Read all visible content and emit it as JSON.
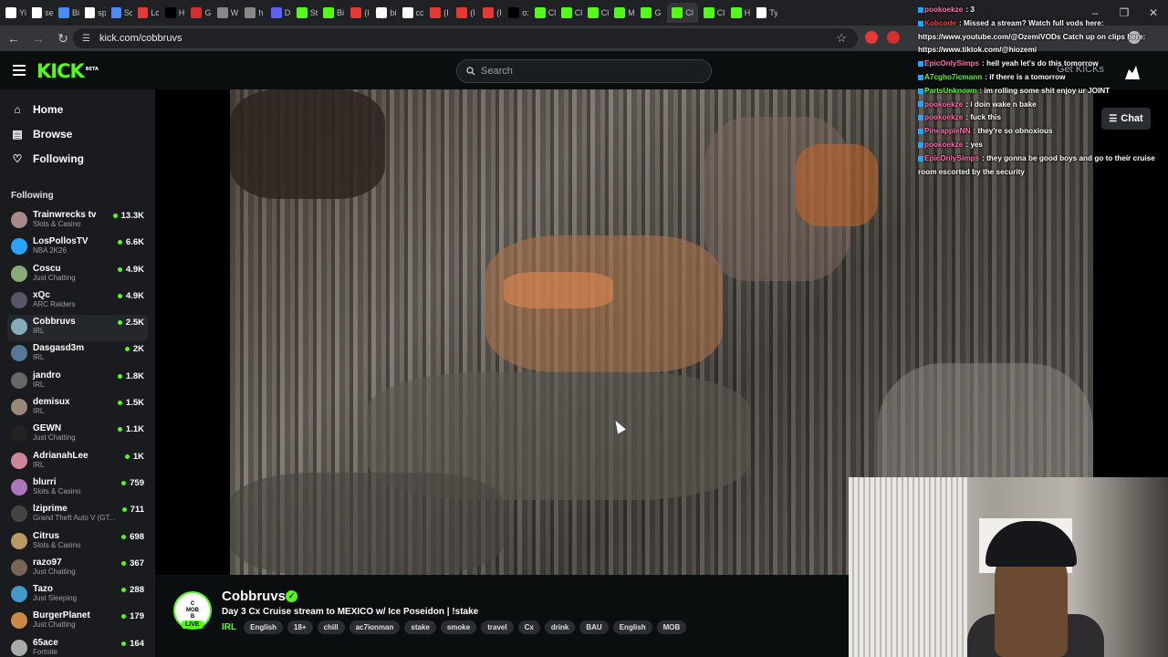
{
  "browser": {
    "url": "kick.com/cobbruvs",
    "tabs": [
      "Yi",
      "se",
      "Bi",
      "sp",
      "Sc",
      "Lc",
      "H",
      "G",
      "W",
      "h",
      "D",
      "St",
      "Bi",
      "(I",
      "bi",
      "cc",
      "(I",
      "(I",
      "(I",
      "o:",
      "Cl",
      "Cl",
      "Cl",
      "M",
      "G",
      "Cl",
      "Cl",
      "H",
      "Ty"
    ]
  },
  "header": {
    "logo": "KICK",
    "logo_badge": "BETA",
    "search_placeholder": "Search",
    "get_kicks": "Get KICKs"
  },
  "nav": {
    "items": [
      {
        "label": "Home",
        "icon": "home-icon"
      },
      {
        "label": "Browse",
        "icon": "browse-icon"
      },
      {
        "label": "Following",
        "icon": "heart-icon"
      }
    ],
    "following_heading": "Following"
  },
  "following": [
    {
      "name": "Trainwrecks tv",
      "category": "Slots & Casino",
      "viewers": "13.3K",
      "color": "#a88"
    },
    {
      "name": "LosPollosTV",
      "category": "NBA 2K26",
      "viewers": "6.6K",
      "color": "#2aa3ff"
    },
    {
      "name": "Coscu",
      "category": "Just Chatting",
      "viewers": "4.9K",
      "color": "#8a7"
    },
    {
      "name": "xQc",
      "category": "ARC Raiders",
      "viewers": "4.9K",
      "color": "#556"
    },
    {
      "name": "Cobbruvs",
      "category": "IRL",
      "viewers": "2.5K",
      "color": "#8ab"
    },
    {
      "name": "Dasgasd3m",
      "category": "IRL",
      "viewers": "2K",
      "color": "#579"
    },
    {
      "name": "jandro",
      "category": "IRL",
      "viewers": "1.8K",
      "color": "#666"
    },
    {
      "name": "demisux",
      "category": "IRL",
      "viewers": "1.5K",
      "color": "#987"
    },
    {
      "name": "GEWN",
      "category": "Just Chatting",
      "viewers": "1.1K",
      "color": "#222"
    },
    {
      "name": "AdrianahLee",
      "category": "IRL",
      "viewers": "1K",
      "color": "#c89"
    },
    {
      "name": "blurri",
      "category": "Slots & Casino",
      "viewers": "759",
      "color": "#a7b"
    },
    {
      "name": "lziprime",
      "category": "Grand Theft Auto V (GT...",
      "viewers": "711",
      "color": "#444"
    },
    {
      "name": "Citrus",
      "category": "Slots & Casino",
      "viewers": "698",
      "color": "#b96"
    },
    {
      "name": "razo97",
      "category": "Just Chatting",
      "viewers": "367",
      "color": "#765"
    },
    {
      "name": "Tazo",
      "category": "Just Sleeping",
      "viewers": "288",
      "color": "#49c"
    },
    {
      "name": "BurgerPlanet",
      "category": "Just Chatting",
      "viewers": "179",
      "color": "#c84"
    },
    {
      "name": "65ace",
      "category": "Fortnite",
      "viewers": "164",
      "color": "#aaa"
    }
  ],
  "chat_button": "Chat",
  "chat": [
    {
      "user": "pookoekze",
      "text": ": 3",
      "ucolor": "#ff6fb0"
    },
    {
      "user": "Kobcode",
      "text": ": Missed a stream? Watch full vods here: https://www.youtube.com/@OzemiVODs Catch up on clips here: https://www.tiktok.com/@hiozemi",
      "ucolor": "#ff3b3b"
    },
    {
      "user": "EpicOnlySimps",
      "text": ": hell yeah let's do this tomorrow",
      "ucolor": "#ff6fb0"
    },
    {
      "user": "A7cgho7icmann",
      "text": ": if there is a tomorrow",
      "ucolor": "#53fc18"
    },
    {
      "user": "PartsUnknown",
      "text": ": im rolling some shit enjoy ur JOINT",
      "ucolor": "#53fc18"
    },
    {
      "user": "pookoekze",
      "text": ": i doin wake n bake",
      "ucolor": "#ff6fb0"
    },
    {
      "user": "pookoekze",
      "text": ": fuck this",
      "ucolor": "#ff6fb0"
    },
    {
      "user": "PineappleNN",
      "text": ": they're so obnoxious",
      "ucolor": "#ff6fb0"
    },
    {
      "user": "pookoekze",
      "text": ": yes",
      "ucolor": "#ff6fb0"
    },
    {
      "user": "EpicOnlySimps",
      "text": ": they gonna be good boys and go to their cruise room escorted by the security",
      "ucolor": "#ff6fb0"
    }
  ],
  "stream": {
    "channel": "Cobbruvs",
    "avatar_text": "C\nMOB\nB",
    "live": "LIVE",
    "title": "Day 3 Cx Cruise stream to MEXICO w/ Ice Poseidon | !stake",
    "category": "IRL",
    "tags": [
      "English",
      "18+",
      "chill",
      "ac7ionman",
      "stake",
      "smoke",
      "travel",
      "Cx",
      "drink",
      "BAU",
      "English",
      "MOB"
    ]
  }
}
